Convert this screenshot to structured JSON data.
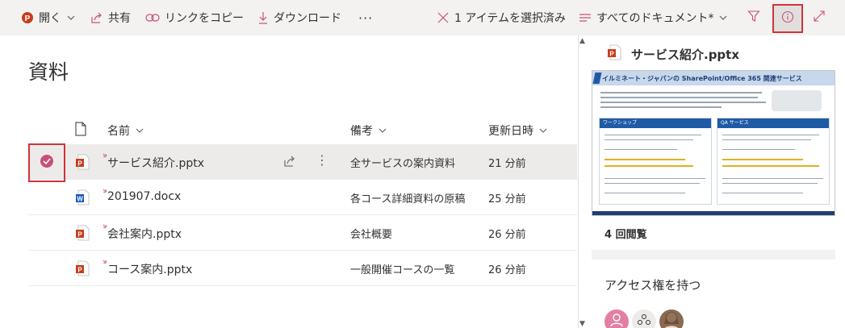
{
  "toolbar": {
    "open_label": "開く",
    "share_label": "共有",
    "copy_link_label": "リンクをコピー",
    "download_label": "ダウンロード",
    "more_label": "···",
    "selection_label": "1 アイテムを選択済み",
    "view_label": "すべてのドキュメント*"
  },
  "library": {
    "title": "資料",
    "columns": {
      "name": "名前",
      "note": "備考",
      "modified": "更新日時"
    },
    "rows": [
      {
        "name": "サービス紹介.pptx",
        "type": "pptx",
        "note": "全サービスの案内資料",
        "modified": "21 分前",
        "selected": true
      },
      {
        "name": "201907.docx",
        "type": "docx",
        "note": "各コース詳細資料の原稿",
        "modified": "25 分前",
        "selected": false
      },
      {
        "name": "会社案内.pptx",
        "type": "pptx",
        "note": "会社概要",
        "modified": "26 分前",
        "selected": false
      },
      {
        "name": "コース案内.pptx",
        "type": "pptx",
        "note": "一般開催コースの一覧",
        "modified": "26 分前",
        "selected": false
      }
    ]
  },
  "details": {
    "file_name": "サービス紹介.pptx",
    "thumbnail_title": "イルミネート・ジャパンの SharePoint/Office 365 関連サービス",
    "thumbnail_box1": "ワークショップ",
    "thumbnail_box2": "QA サービス",
    "views": "4 回閲覧",
    "access_heading": "アクセス権を持つ"
  },
  "colors": {
    "accent_red": "#d13438",
    "ppt_red": "#c43e1c",
    "word_blue": "#185abd",
    "check_pink": "#c94f7c",
    "toolbar_bg": "#f3f2f1"
  }
}
